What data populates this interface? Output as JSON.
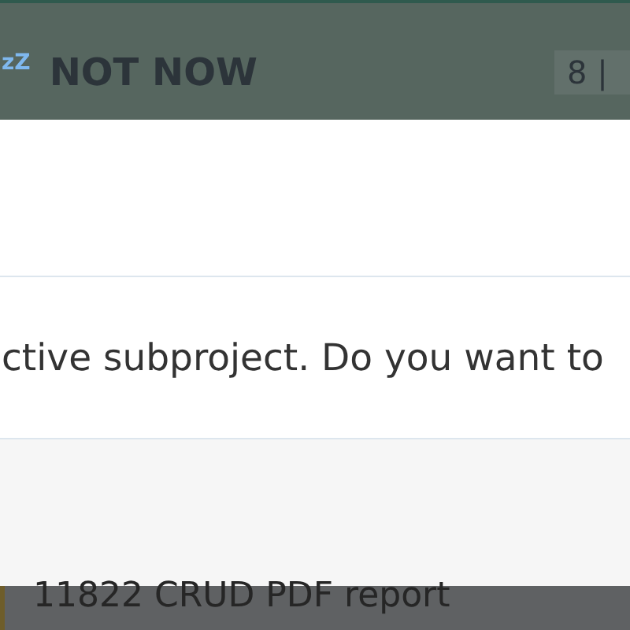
{
  "top_bar": {
    "snooze_glyph": "zZ",
    "title": "NOT NOW",
    "counter": "8 |"
  },
  "dialog": {
    "message": "ctive subproject. Do you want to"
  },
  "background_row": {
    "label": "11822 CRUD PDF report"
  }
}
